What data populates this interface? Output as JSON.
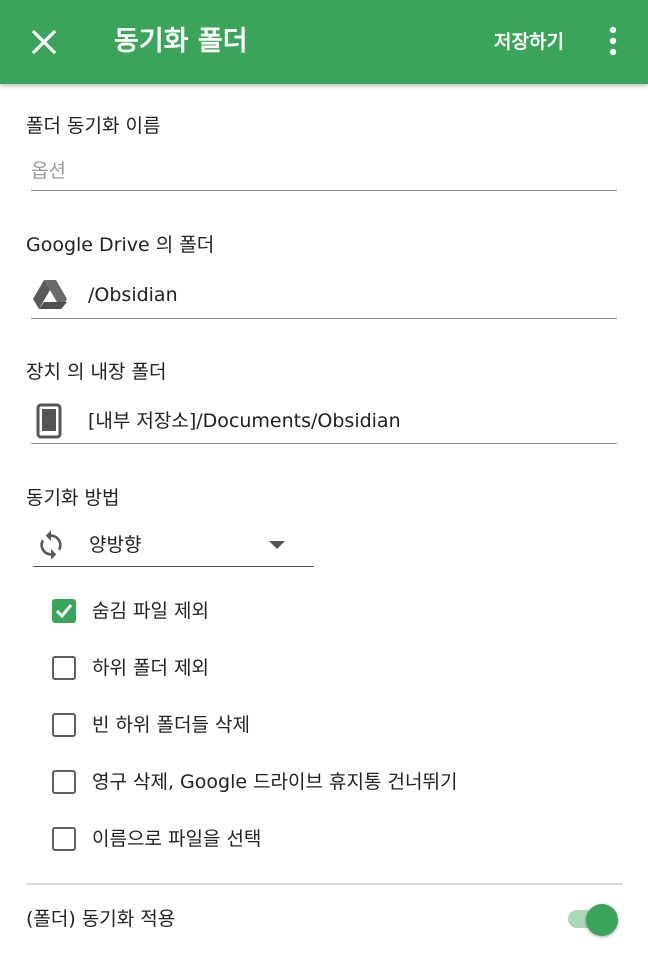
{
  "appbar": {
    "title": "동기화 폴더",
    "save_label": "저장하기",
    "close_icon": "close-icon",
    "more_icon": "more-vert-icon",
    "color": "#3aa45a"
  },
  "sync_name": {
    "label": "폴더 동기화 이름",
    "placeholder": "옵션",
    "value": ""
  },
  "drive_folder": {
    "label": "Google Drive 의 폴더",
    "value": "/Obsidian",
    "icon": "google-drive-icon"
  },
  "device_folder": {
    "label": "장치 의 내장 폴더",
    "value": "[내부 저장소]/Documents/Obsidian",
    "icon": "phone-icon"
  },
  "sync_method": {
    "label": "동기화 방법",
    "selected": "양방향",
    "icon": "sync-icon"
  },
  "options": [
    {
      "label": "숨김 파일 제외",
      "checked": true
    },
    {
      "label": "하위 폴더 제외",
      "checked": false
    },
    {
      "label": "빈 하위 폴더들 삭제",
      "checked": false
    },
    {
      "label": "영구 삭제, Google 드라이브 휴지통 건너뛰기",
      "checked": false
    },
    {
      "label": "이름으로 파일을 선택",
      "checked": false
    }
  ],
  "apply_sync": {
    "label": "(폴더) 동기화 적용",
    "enabled": true
  }
}
